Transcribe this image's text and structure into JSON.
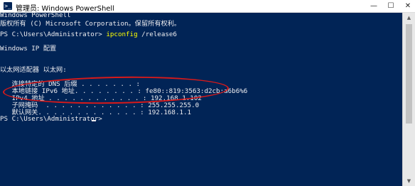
{
  "window": {
    "title": "管理员: Windows PowerShell",
    "icon_text": ">_",
    "minimize_glyph": "—",
    "maximize_glyph": "☐",
    "close_glyph": "✕"
  },
  "console": {
    "banner": "Windows PowerShell",
    "copyright": "版权所有 (C) Microsoft Corporation。保留所有权利。",
    "prompt1": "PS C:\\Users\\Administrator> ",
    "command": "ipconfig",
    "command_arg": " /release6",
    "ip_config_heading": "Windows IP 配置",
    "adapter_heading": "以太网适配器 以太网:",
    "dns_suffix": "   连接特定的 DNS 后缀 . . . . . . . :",
    "ipv6": "   本地链接 IPv6 地址. . . . . . . . : fe80::819:3563:d2cb:a6b6%6",
    "ipv4": "   IPv4 地址 . . . . . . . . . . . . : 192.168.1.102",
    "subnet": "   子网掩码  . . . . . . . . . . . . : 255.255.255.0",
    "gateway": "   默认网关. . . . . . . . . . . . . : 192.168.1.1",
    "prompt2": "PS C:\\Users\\Administrator> "
  },
  "colors": {
    "console_background": "#012456",
    "console_text": "#eeedf0",
    "command_highlight": "#ffff00",
    "annotation_circle": "#d81a1a"
  }
}
